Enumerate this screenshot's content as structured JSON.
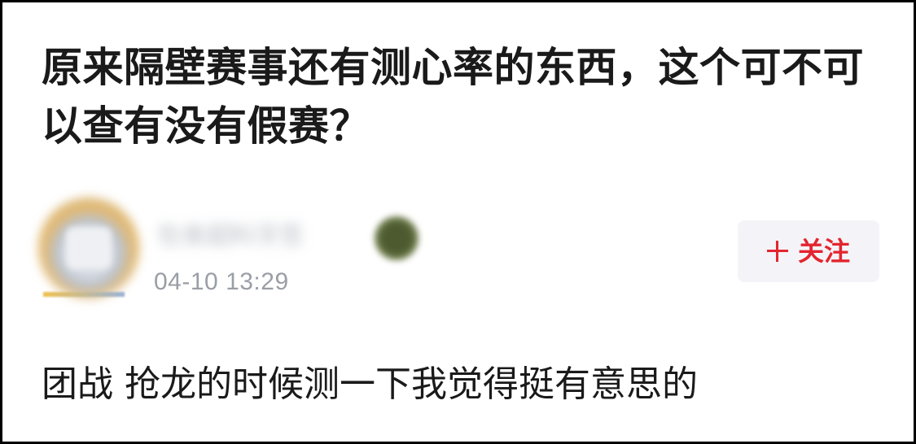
{
  "post": {
    "title": "原来隔壁赛事还有测心率的东西，这个可不可以查有没有假赛？"
  },
  "author": {
    "username": "包食超料牙签",
    "avatar_icon": "user-avatar",
    "badge_icon": "user-level-badge",
    "post_time": "04-10 13:29"
  },
  "follow_button": {
    "label": "关注",
    "icon": "plus-icon",
    "accent_color": "#e3252f",
    "background": "#f4f4f8"
  },
  "reply": {
    "text": "团战 抢龙的时候测一下我觉得挺有意思的"
  }
}
